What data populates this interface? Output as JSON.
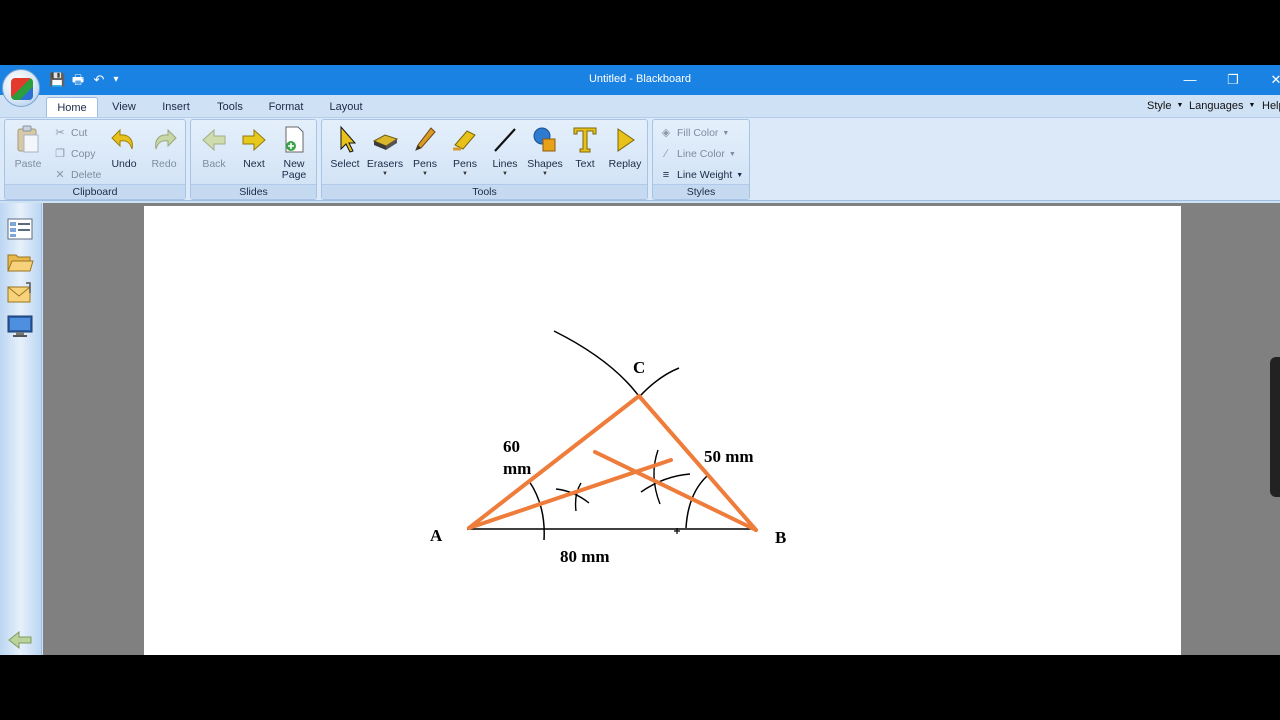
{
  "window": {
    "title": "Untitled - Blackboard",
    "controls": {
      "minimize": "—",
      "restore": "❐",
      "close": "✕"
    }
  },
  "quick_access": {
    "save": "💾",
    "print": "🖶",
    "undo": "↶",
    "more": "▾"
  },
  "tabs": [
    {
      "label": "Home",
      "active": true
    },
    {
      "label": "View"
    },
    {
      "label": "Insert"
    },
    {
      "label": "Tools"
    },
    {
      "label": "Format"
    },
    {
      "label": "Layout"
    }
  ],
  "right_menus": {
    "style": "Style",
    "languages": "Languages",
    "help": "Help"
  },
  "ribbon": {
    "clipboard": {
      "label": "Clipboard",
      "paste": "Paste",
      "cut": "Cut",
      "copy": "Copy",
      "delete": "Delete",
      "undo": "Undo",
      "redo": "Redo"
    },
    "slides": {
      "label": "Slides",
      "back": "Back",
      "next": "Next",
      "new_page": "New\nPage"
    },
    "tools": {
      "label": "Tools",
      "select": "Select",
      "erasers": "Erasers",
      "pens": "Pens",
      "highlighter_pens": "Pens",
      "lines": "Lines",
      "shapes": "Shapes",
      "text": "Text",
      "replay": "Replay"
    },
    "styles": {
      "label": "Styles",
      "fill_color": "Fill Color",
      "line_color": "Line Color",
      "line_weight": "Line Weight"
    }
  },
  "drawing": {
    "vertex_a": "A",
    "vertex_b": "B",
    "vertex_c": "C",
    "side_ac_line1": "60",
    "side_ac_line2": "mm",
    "side_bc": "50 mm",
    "side_ab": "80 mm",
    "triangle_color": "#ee7c3a",
    "construction_color": "#000000"
  }
}
